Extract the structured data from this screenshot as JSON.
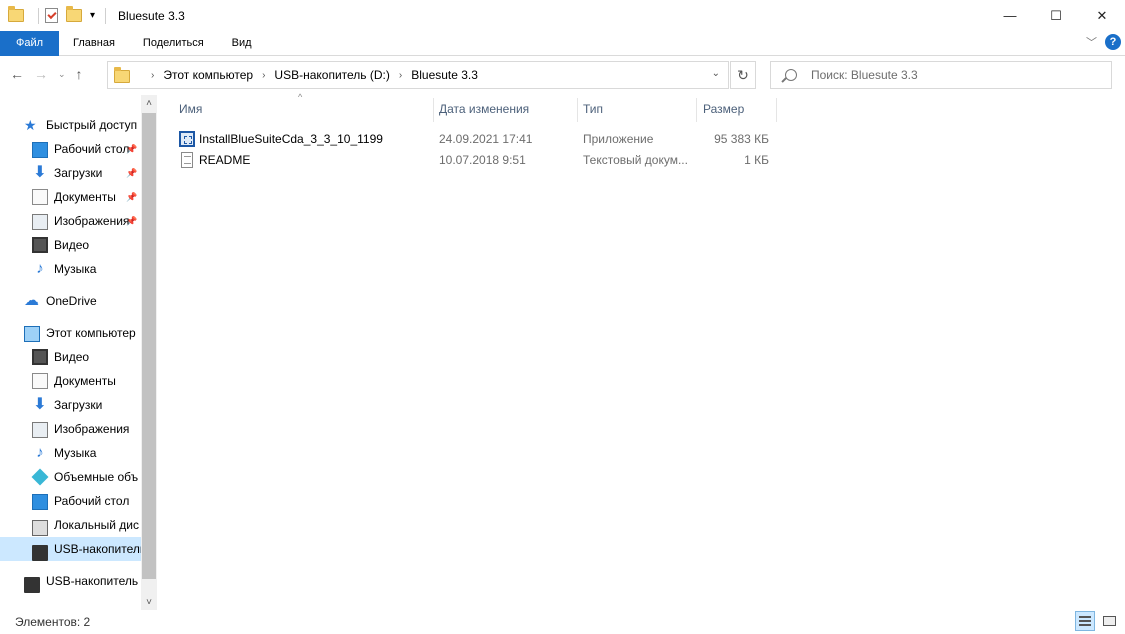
{
  "window": {
    "title": "Bluesute 3.3",
    "controls": {
      "minimize": "—",
      "maximize": "☐",
      "close": "✕"
    }
  },
  "ribbon": {
    "tabs": [
      "Файл",
      "Главная",
      "Поделиться",
      "Вид"
    ],
    "accent": "#1a6fc9"
  },
  "address": {
    "crumbs": [
      "Этот компьютер",
      "USB-накопитель (D:)",
      "Bluesute 3.3"
    ]
  },
  "search": {
    "placeholder": "Поиск: Bluesute 3.3"
  },
  "sidebar": {
    "items": [
      {
        "label": "Быстрый доступ",
        "icon": "star-icon",
        "level": 0,
        "pinned": false
      },
      {
        "label": "Рабочий стол",
        "icon": "desktop-icon",
        "level": 1,
        "pinned": true
      },
      {
        "label": "Загрузки",
        "icon": "downloads-icon",
        "level": 1,
        "pinned": true
      },
      {
        "label": "Документы",
        "icon": "documents-icon",
        "level": 1,
        "pinned": true
      },
      {
        "label": "Изображения",
        "icon": "pictures-icon",
        "level": 1,
        "pinned": true
      },
      {
        "label": "Видео",
        "icon": "video-icon",
        "level": 1,
        "pinned": false
      },
      {
        "label": "Музыка",
        "icon": "music-icon",
        "level": 1,
        "pinned": false
      },
      {
        "label": "OneDrive",
        "icon": "onedrive-icon",
        "level": 0,
        "pinned": false
      },
      {
        "label": "Этот компьютер",
        "icon": "this-pc-icon",
        "level": 0,
        "pinned": false
      },
      {
        "label": "Видео",
        "icon": "video-icon",
        "level": 1,
        "pinned": false
      },
      {
        "label": "Документы",
        "icon": "documents-icon",
        "level": 1,
        "pinned": false
      },
      {
        "label": "Загрузки",
        "icon": "downloads-icon",
        "level": 1,
        "pinned": false
      },
      {
        "label": "Изображения",
        "icon": "pictures-icon",
        "level": 1,
        "pinned": false
      },
      {
        "label": "Музыка",
        "icon": "music-icon",
        "level": 1,
        "pinned": false
      },
      {
        "label": "Объемные объ",
        "icon": "3d-objects-icon",
        "level": 1,
        "pinned": false
      },
      {
        "label": "Рабочий стол",
        "icon": "desktop-icon",
        "level": 1,
        "pinned": false
      },
      {
        "label": "Локальный дис",
        "icon": "local-disk-icon",
        "level": 1,
        "pinned": false
      },
      {
        "label": "USB-накопитель",
        "icon": "usb-drive-icon",
        "level": 1,
        "pinned": false,
        "selected": true
      },
      {
        "label": "USB-накопитель",
        "icon": "usb-drive-icon",
        "level": 0,
        "pinned": false
      }
    ]
  },
  "columns": {
    "name": "Имя",
    "date": "Дата изменения",
    "type": "Тип",
    "size": "Размер"
  },
  "files": [
    {
      "name": "InstallBlueSuiteCda_3_3_10_1199",
      "date": "24.09.2021 17:41",
      "type": "Приложение",
      "size": "95 383 КБ",
      "icon": "application-icon"
    },
    {
      "name": "README",
      "date": "10.07.2018 9:51",
      "type": "Текстовый докум...",
      "size": "1 КБ",
      "icon": "text-document-icon"
    }
  ],
  "status": {
    "item_count": "Элементов: 2"
  }
}
